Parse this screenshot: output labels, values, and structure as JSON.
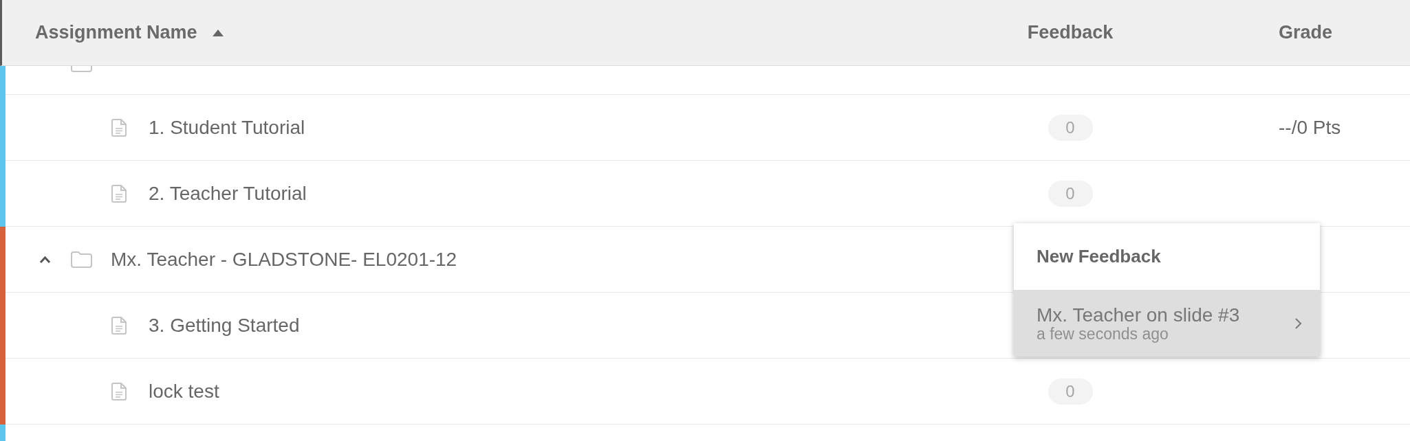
{
  "table": {
    "columns": [
      {
        "label": "Assignment Name",
        "sorted": true,
        "ascending": true
      },
      {
        "label": "Feedback",
        "sorted": false
      },
      {
        "label": "Grade",
        "sorted": false
      }
    ],
    "groups": [
      {
        "kind": "clipped_top",
        "color": "#5bc5ec",
        "expanded": true,
        "items": [
          {
            "name": "1. Student Tutorial",
            "feedback": "0",
            "grade": "--/0 Pts"
          },
          {
            "name": "2. Teacher Tutorial",
            "feedback": "0"
          }
        ]
      },
      {
        "kind": "folder",
        "name": "Mx. Teacher - GLADSTONE- EL0201-12",
        "color": "#d5623b",
        "expanded": true,
        "items": [
          {
            "name": "3. Getting Started"
          },
          {
            "name": "lock test",
            "feedback": "0"
          }
        ]
      },
      {
        "kind": "clipped_bottom",
        "color": "#5bc5ec"
      }
    ]
  },
  "feedback_menu": {
    "items": [
      {
        "kind": "new",
        "label": "New Feedback",
        "selected": false
      },
      {
        "kind": "entry",
        "author": "Mx. Teacher on slide #3",
        "time": "a few seconds ago",
        "selected": true
      }
    ]
  }
}
